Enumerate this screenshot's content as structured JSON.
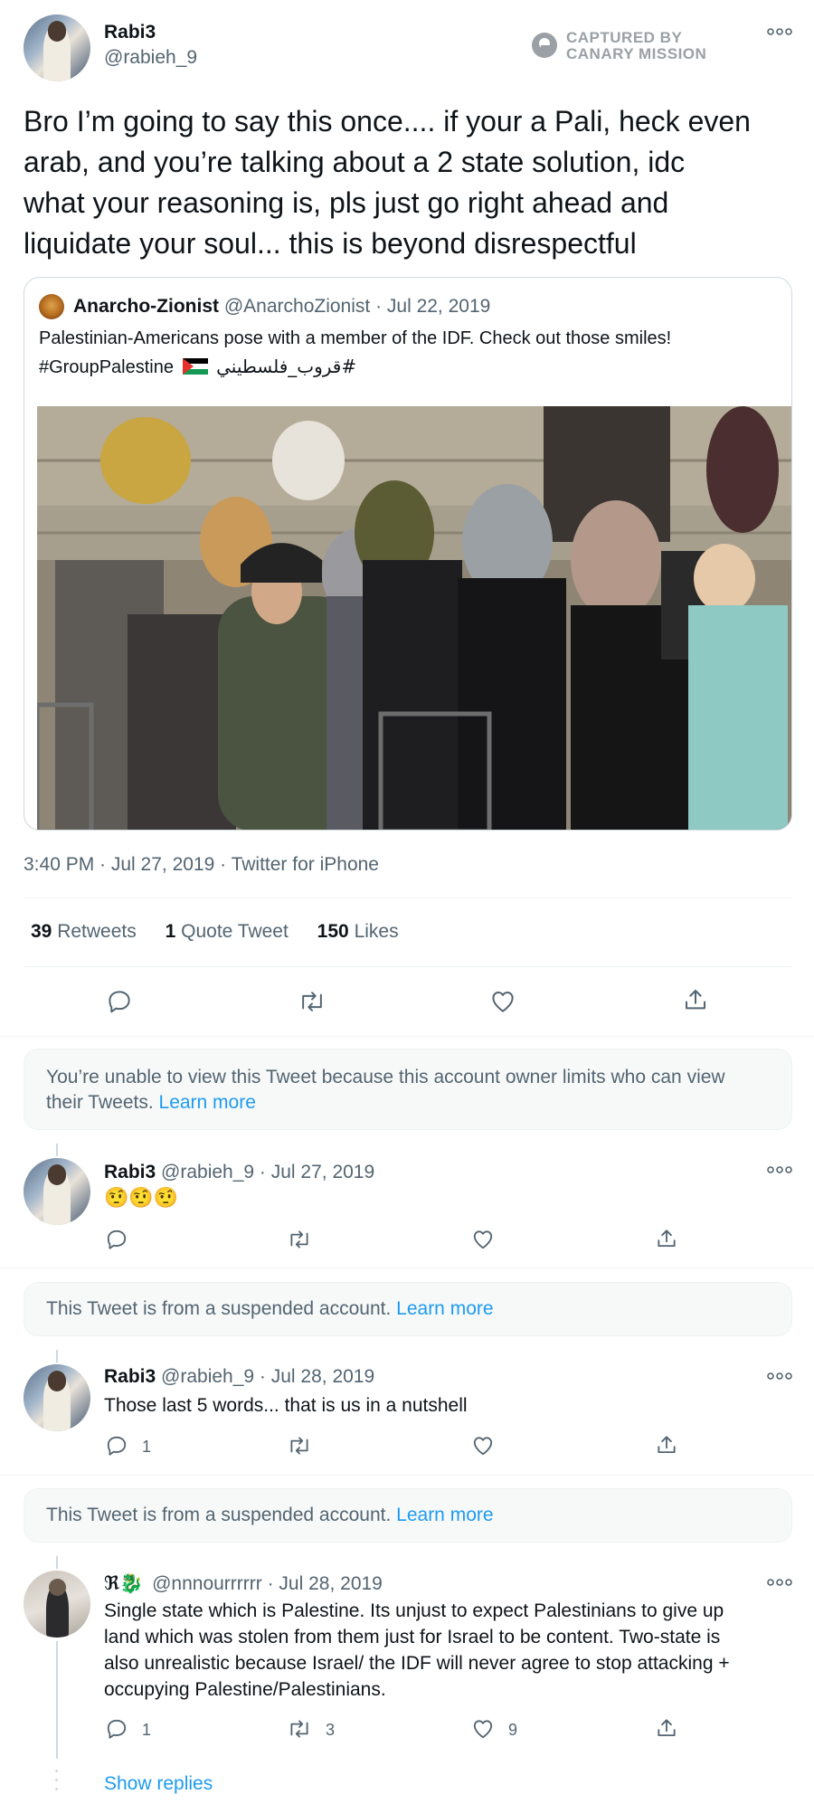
{
  "main_tweet": {
    "name": "Rabi3",
    "handle": "@rabieh_9",
    "watermark_line1": "CAPTURED BY",
    "watermark_line2": "CANARY MISSION",
    "text_lines": [
      "Bro I’m going to say this once.... if your a Pali, heck even",
      "arab, and you’re talking about a 2 state solution, idc",
      "what your reasoning is, pls just go right ahead and",
      "liquidate your soul... this is beyond disrespectful"
    ],
    "quoted": {
      "name": "Anarcho-Zionist",
      "meta": "@AnarchoZionist · Jul 22, 2019",
      "line1": "Palestinian-Americans pose with a member of the IDF.  Check out those smiles!",
      "line2_prefix": "#GroupPalestine",
      "line2_arabic": "#قروب_فلسطيني"
    },
    "timestamp": "3:40 PM · Jul 27, 2019 · Twitter for iPhone",
    "stats": {
      "retweets_num": "39",
      "retweets_label": "Retweets",
      "quotes_num": "1",
      "quotes_label": "Quote Tweet",
      "likes_num": "150",
      "likes_label": "Likes"
    }
  },
  "notices": [
    {
      "line1": "You’re unable to view this Tweet because this account owner limits who can view",
      "line2": "their Tweets.",
      "link": "Learn more"
    },
    {
      "text": "This Tweet is from a suspended account.",
      "link": "Learn more"
    },
    {
      "text": "This Tweet is from a suspended account.",
      "link": "Learn more"
    }
  ],
  "replies": [
    {
      "name": "Rabi3",
      "meta": "@rabieh_9 · Jul 27, 2019",
      "text": "🤨🤨🤨",
      "reply_count": "",
      "retweet_count": "",
      "like_count": ""
    },
    {
      "name": "Rabi3",
      "meta": "@rabieh_9 · Jul 28, 2019",
      "text": "Those last 5 words... that is us in a nutshell",
      "reply_count": "1",
      "retweet_count": "",
      "like_count": ""
    },
    {
      "name": "ℜ🐉",
      "meta": "@nnnourrrrrr · Jul 28, 2019",
      "lines": [
        "Single state which is Palestine. Its unjust to expect Palestinians to give up",
        "land which was stolen from them just for Israel to be content. Two-state is",
        "also unrealistic because Israel/ the IDF will never agree to stop attacking +",
        "occupying Palestine/Palestinians."
      ],
      "reply_count": "1",
      "retweet_count": "3",
      "like_count": "9"
    }
  ],
  "show_replies": "Show replies",
  "colors": {
    "accent": "#1d9bf0",
    "muted": "#536471",
    "border": "#cfd9de"
  }
}
